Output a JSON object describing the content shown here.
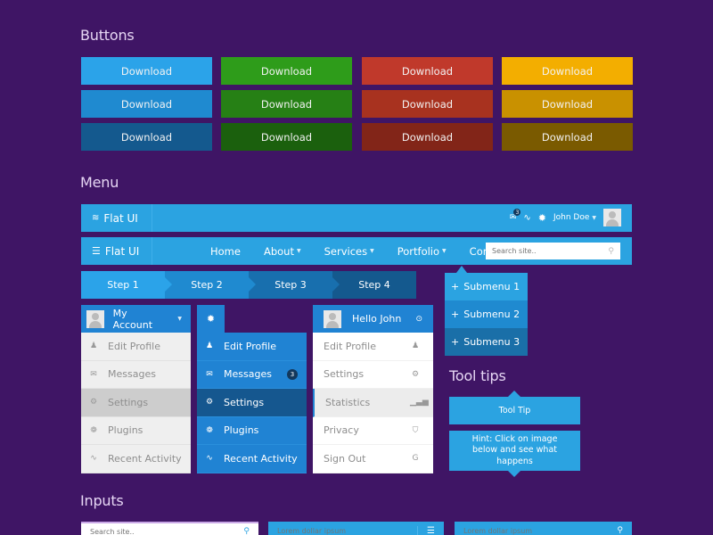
{
  "sections": {
    "buttons": "Buttons",
    "menu": "Menu",
    "tooltips": "Tool tips",
    "inputs": "Inputs"
  },
  "buttons": {
    "label": "Download",
    "colors": {
      "blue": [
        "#2ba3e9",
        "#1f8ad0",
        "#14598e"
      ],
      "green": [
        "#2e9c1a",
        "#268015",
        "#1b600d"
      ],
      "red": [
        "#c0392b",
        "#a8321f",
        "#822518"
      ],
      "yellow": [
        "#f3ae00",
        "#c99100",
        "#7a5a00"
      ]
    }
  },
  "navbar1": {
    "brand": "Flat UI",
    "notification_count": "3",
    "user_name": "John Doe"
  },
  "navbar2": {
    "brand": "Flat UI",
    "links": [
      {
        "label": "Home",
        "has_caret": false
      },
      {
        "label": "About",
        "has_caret": true
      },
      {
        "label": "Services",
        "has_caret": true
      },
      {
        "label": "Portfolio",
        "has_caret": true
      },
      {
        "label": "Contact",
        "has_caret": false
      }
    ],
    "search_placeholder": "Search site.."
  },
  "steps": [
    "Step 1",
    "Step 2",
    "Step 3",
    "Step 4"
  ],
  "account_menu": {
    "title": "My Account",
    "items": [
      "Edit Profile",
      "Messages",
      "Settings",
      "Plugins",
      "Recent Activity"
    ],
    "active": "Settings"
  },
  "gear_menu": {
    "items": [
      "Edit Profile",
      "Messages",
      "Settings",
      "Plugins",
      "Recent Activity"
    ],
    "messages_badge": "3",
    "active": "Settings"
  },
  "user_menu": {
    "title": "Hello John",
    "items": [
      "Edit Profile",
      "Settings",
      "Statistics",
      "Privacy",
      "Sign Out"
    ],
    "active": "Statistics"
  },
  "submenu": [
    "Submenu 1",
    "Submenu 2",
    "Submenu 3"
  ],
  "tooltips": {
    "tip": "Tool Tip",
    "hint": "Hint: Click on image below and see what happens"
  },
  "inputs": {
    "search_placeholder": "Search site..",
    "input2_placeholder": "Lorem dollar ipsum",
    "input3_placeholder": "Lorem dollar ipsum"
  }
}
